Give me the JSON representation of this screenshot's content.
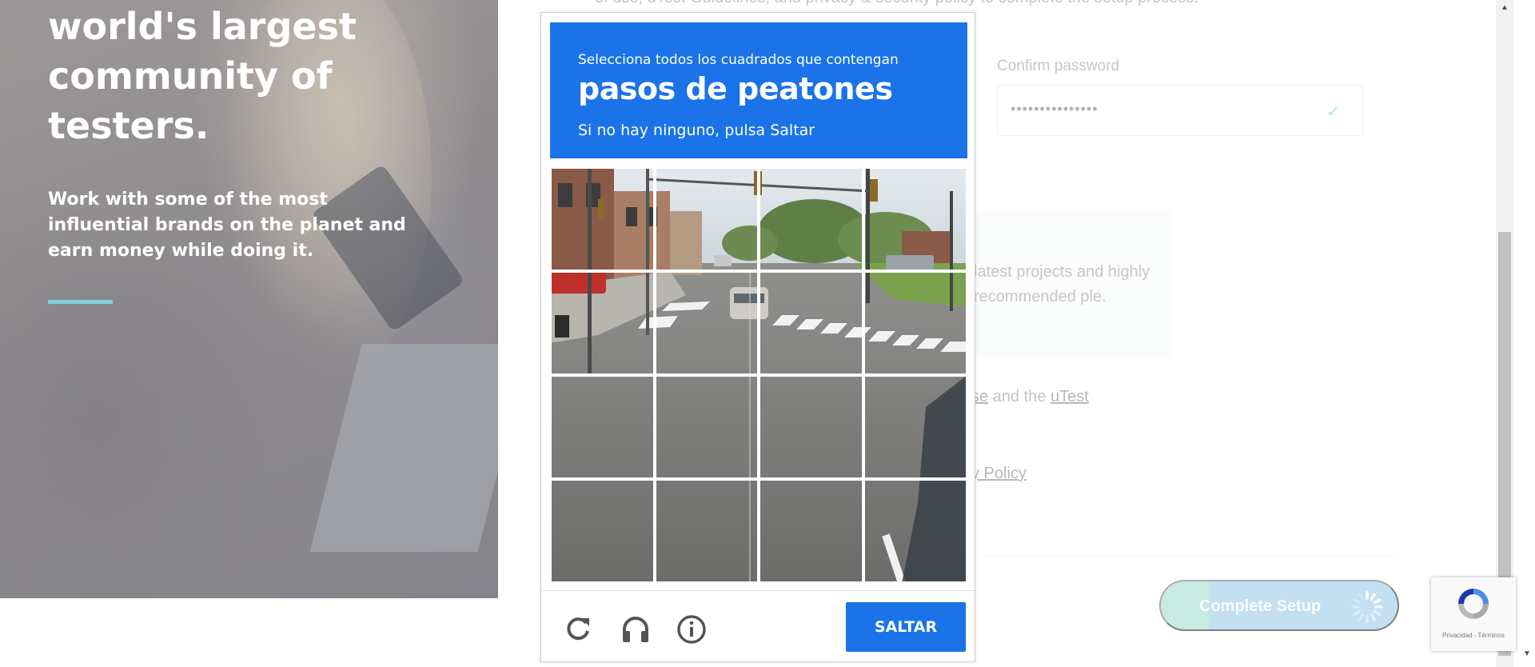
{
  "hero": {
    "title": "world's largest community of testers.",
    "subtitle": "Work with some of the most influential brands on the planet and earn money while doing it.",
    "accent_color": "#7fd0dd"
  },
  "form": {
    "top_text": "of use, uTest Guidelines, and privacy & security policy to complete the setup process.",
    "confirm_label": "Confirm password",
    "confirm_value": "•••••••••••••••",
    "info_text": "latest projects and highly recommended ple.",
    "terms_prefix": "se",
    "terms_middle": " and the ",
    "terms_link": "uTest",
    "privacy_link": "y Policy",
    "complete_button": "Complete Setup"
  },
  "captcha": {
    "instruction": "Selecciona todos los cuadrados que contengan",
    "target": "pasos de peatones",
    "skip_hint": "Si no hay ninguno, pulsa Saltar",
    "skip_button": "SALTAR",
    "grid_rows": 4,
    "grid_cols": 4,
    "icons": [
      "reload-icon",
      "headphones-icon",
      "info-icon"
    ],
    "header_color": "#1a73e8"
  },
  "recaptcha_badge": {
    "text": "Privacidad - Términos"
  }
}
